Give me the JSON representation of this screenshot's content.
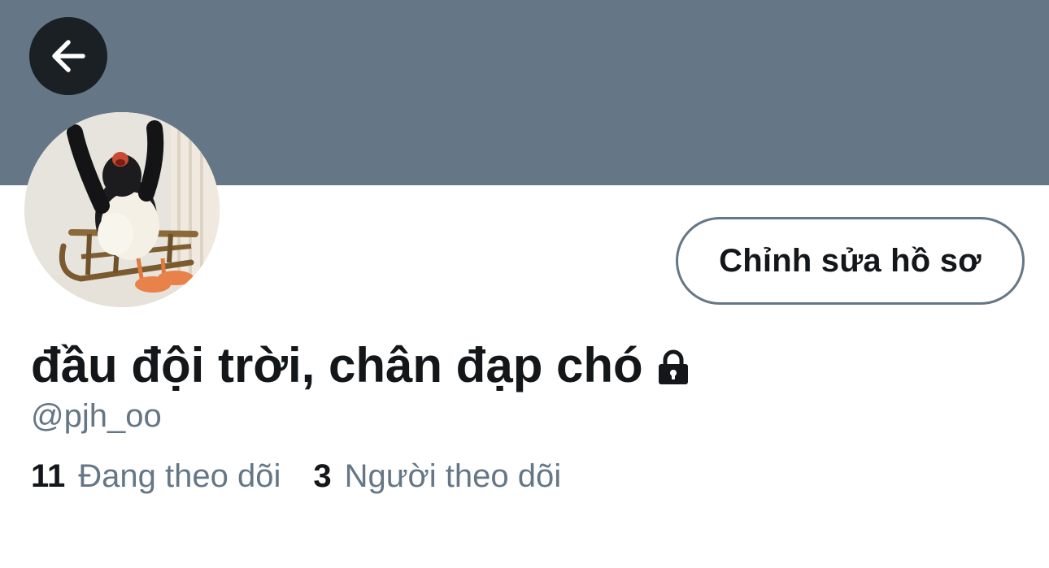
{
  "profile": {
    "display_name": "đầu đội trời, chân đạp chó",
    "handle": "@pjh_oo",
    "locked": true,
    "edit_button_label": "Chỉnh sửa hồ sơ"
  },
  "stats": {
    "following_count": "11",
    "following_label": "Đang theo dõi",
    "followers_count": "3",
    "followers_label": "Người theo dõi"
  },
  "icons": {
    "back": "arrow-left-icon",
    "lock": "lock-icon"
  },
  "colors": {
    "banner": "#657786",
    "primary_text": "#14171a",
    "secondary_text": "#657786",
    "back_button_bg": "#1b2024",
    "button_border": "#657786"
  }
}
